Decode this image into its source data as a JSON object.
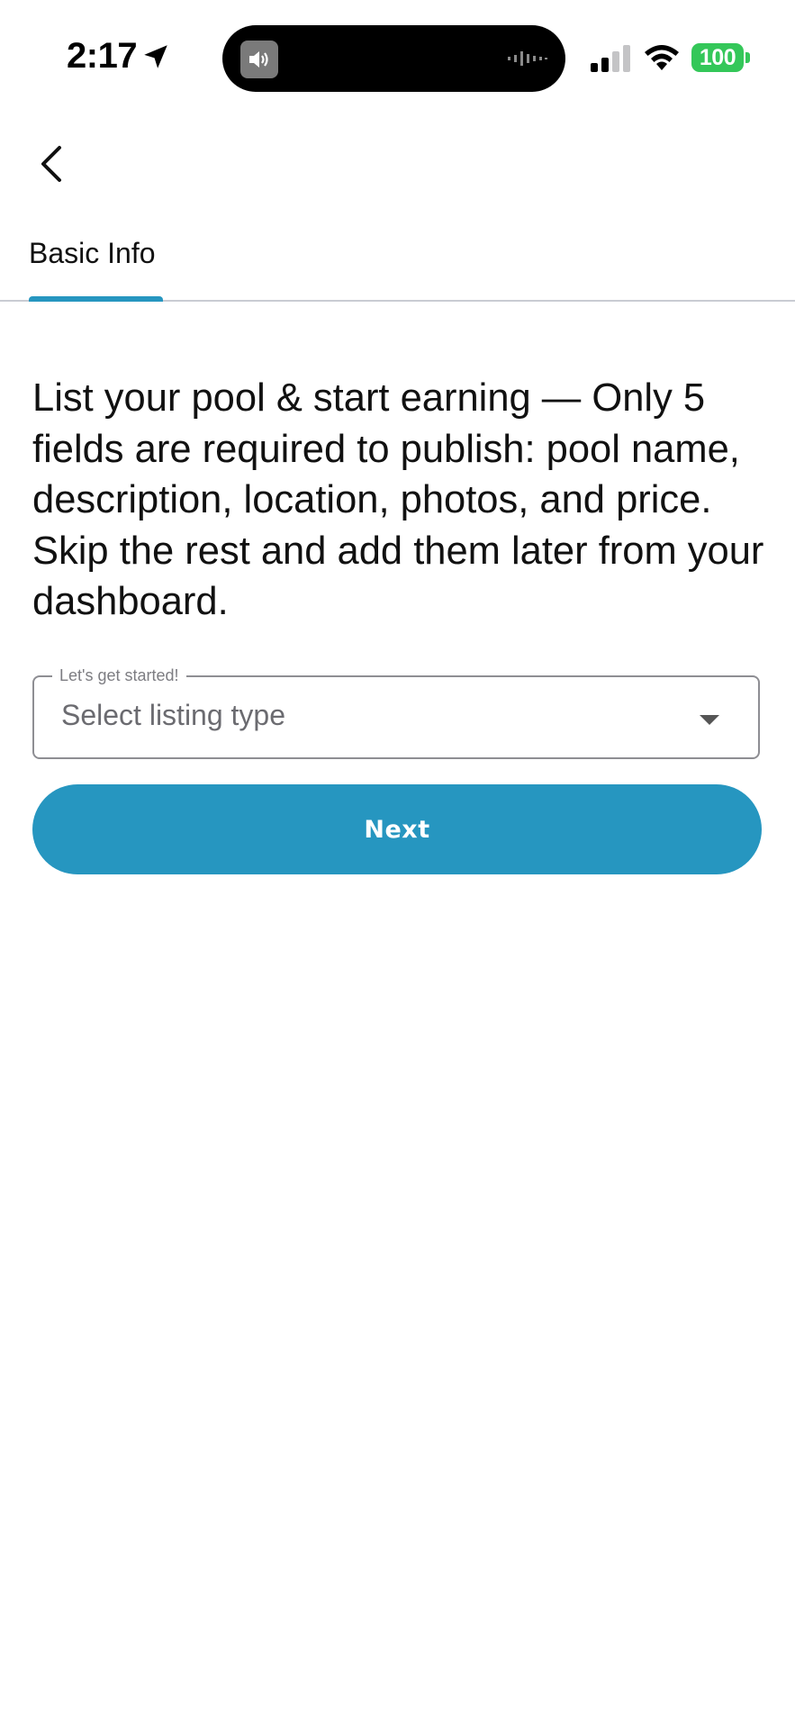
{
  "status_bar": {
    "time": "2:17",
    "battery": "100",
    "icons": [
      "location-arrow-icon",
      "speaker-icon",
      "audio-wave-icon",
      "signal-icon",
      "wifi-icon",
      "battery-icon"
    ]
  },
  "nav": {
    "back_icon": "chevron-left-icon"
  },
  "tabs": [
    {
      "label": "Basic Info",
      "active": true
    }
  ],
  "main": {
    "intro": "List your pool & start earning — Only 5 fields are required to publish: pool name, description, location, photos, and price. Skip the rest and add them later from your dashboard.",
    "listing_type": {
      "legend": "Let's get started!",
      "placeholder": "Select listing type",
      "icon": "dropdown-caret-icon"
    },
    "next_label": "Next"
  },
  "colors": {
    "accent": "#2696c0",
    "battery": "#34c759",
    "divider": "#c9ccd3",
    "text": "#111111",
    "muted": "#6b6b70"
  }
}
